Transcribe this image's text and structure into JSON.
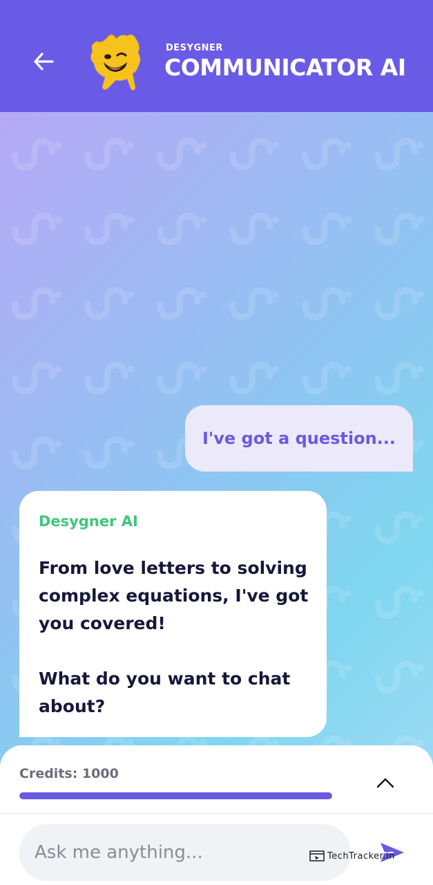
{
  "header": {
    "brand_small": "DESYGNER",
    "brand_title": "COMMUNICATOR AI",
    "back_icon": "arrow-left-icon",
    "background": "#6a5be6"
  },
  "chat": {
    "user_message": "I've got a question...",
    "ai_sender": "Desygner AI",
    "ai_message": "From love letters to solving complex equations, I've got you covered!\n\nWhat do you want to chat about?"
  },
  "credits": {
    "label": "Credits: 1000",
    "progress_fraction": 1.0,
    "toggle_icon": "chevron-up-icon"
  },
  "composer": {
    "placeholder": "Ask me anything...",
    "send_icon": "send-icon"
  },
  "watermark": {
    "text": "TechTracker.in"
  },
  "colors": {
    "accent": "#6a5ae0",
    "ai_name": "#3ec77b",
    "ai_text": "#16183a"
  }
}
